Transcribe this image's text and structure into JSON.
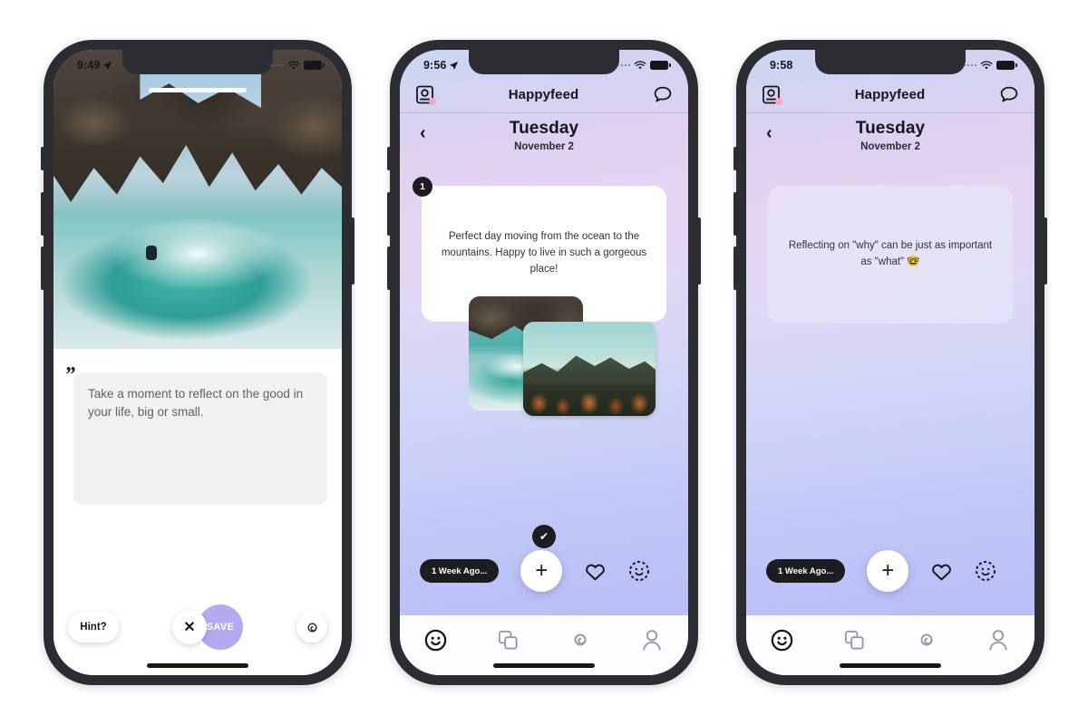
{
  "phones": [
    {
      "id": "compose",
      "status": {
        "time": "9:49",
        "location_arrow": true,
        "wifi": "wifi-icon",
        "battery": "battery-icon"
      },
      "prompt_placeholder": "Take a moment to reflect on the good in your life, big or small.",
      "quote_glyph": "”",
      "photo_alt": "surfer riding a wave beneath dark sea cliffs",
      "actions": {
        "hint_label": "Hint?",
        "close_label": "✕",
        "save_label": "SAVE",
        "spiral_label": "spiral-icon"
      },
      "accent_color": "#b3aaf0"
    },
    {
      "id": "feed-entry",
      "status": {
        "time": "9:56",
        "location_arrow": true,
        "wifi": "wifi-icon",
        "battery": "battery-icon"
      },
      "appbar": {
        "title": "Happyfeed",
        "left_icon": "camera-badge-icon",
        "right_icon": "chat-bubble-icon"
      },
      "datehead": {
        "back_label": "‹",
        "day": "Tuesday",
        "date": "November 2"
      },
      "entry": {
        "badge": "1",
        "text": "Perfect day moving from the ocean to the mountains. Happy to live in such a gorgeous place!",
        "photos": [
          "ocean-wave-photo",
          "mountain-autumn-photo"
        ]
      },
      "check_pip": "✔",
      "actions": {
        "week_pill": "1 Week Ago...",
        "plus_label": "+",
        "heart_label": "heart-icon",
        "smiley_label": "dashed-smiley-icon"
      },
      "tabs": [
        {
          "name": "smiley",
          "active": true
        },
        {
          "name": "cards",
          "active": false
        },
        {
          "name": "spiral",
          "active": false
        },
        {
          "name": "person",
          "active": false
        }
      ]
    },
    {
      "id": "feed-reflection",
      "status": {
        "time": "9:58",
        "location_arrow": false,
        "wifi": "wifi-icon",
        "battery": "battery-icon"
      },
      "appbar": {
        "title": "Happyfeed",
        "left_icon": "camera-badge-icon",
        "right_icon": "chat-bubble-icon"
      },
      "datehead": {
        "back_label": "‹",
        "day": "Tuesday",
        "date": "November 2"
      },
      "entry": {
        "badge": "",
        "text": "Reflecting on \"why\" can be just as important as \"what\" 🤓",
        "photos": []
      },
      "actions": {
        "week_pill": "1 Week Ago...",
        "plus_label": "+",
        "heart_label": "heart-icon",
        "smiley_label": "dashed-smiley-icon"
      },
      "tabs": [
        {
          "name": "smiley",
          "active": true
        },
        {
          "name": "cards",
          "active": false
        },
        {
          "name": "spiral",
          "active": false
        },
        {
          "name": "person",
          "active": false
        }
      ]
    }
  ]
}
